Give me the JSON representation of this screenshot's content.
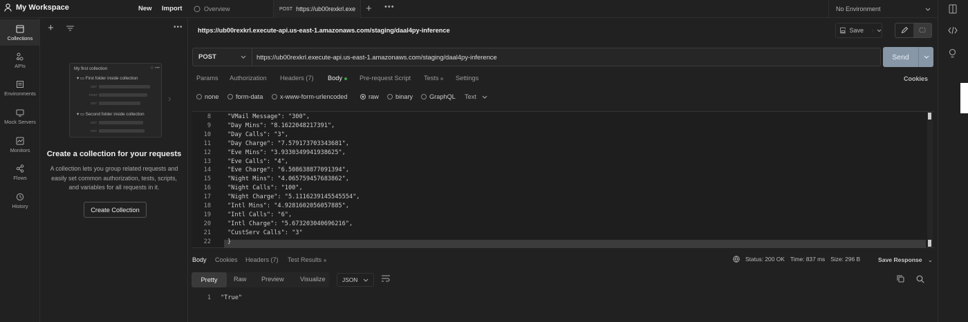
{
  "workspace": {
    "name": "My Workspace",
    "new_label": "New",
    "import_label": "Import"
  },
  "tabs": [
    {
      "label": "Overview"
    },
    {
      "method": "POST",
      "label": "https://ub00rexkrl.exe"
    }
  ],
  "environment": {
    "selected": "No Environment"
  },
  "left_nav": [
    {
      "label": "Collections"
    },
    {
      "label": "APIs"
    },
    {
      "label": "Environments"
    },
    {
      "label": "Mock Servers"
    },
    {
      "label": "Monitors"
    },
    {
      "label": "Flows"
    },
    {
      "label": "History"
    }
  ],
  "sidebar": {
    "illustration": {
      "collection": "My first collection",
      "folder1": "First folder inside collection",
      "folder2": "Second folder inside collection",
      "methods": [
        "GET",
        "POST",
        "GET",
        "GET",
        "GET"
      ]
    },
    "empty_title": "Create a collection for your requests",
    "empty_desc": "A collection lets you group related requests and easily set common authorization, tests, scripts, and variables for all requests in it.",
    "create_button": "Create Collection"
  },
  "request": {
    "title": "https://ub00rexkrl.execute-api.us-east-1.amazonaws.com/staging/daal4py-inference",
    "save_label": "Save",
    "method": "POST",
    "url": "https://ub00rexkrl.execute-api.us-east-1.amazonaws.com/staging/daal4py-inference",
    "send_label": "Send",
    "tabs": [
      "Params",
      "Authorization",
      "Headers (7)",
      "Body",
      "Pre-request Script",
      "Tests",
      "Settings"
    ],
    "cookies_label": "Cookies",
    "body_options": [
      "none",
      "form-data",
      "x-www-form-urlencoded",
      "raw",
      "binary",
      "GraphQL"
    ],
    "body_type": "Text",
    "body_lines": [
      {
        "n": "8",
        "text": "\"VMail Message\": \"300\","
      },
      {
        "n": "9",
        "text": "\"Day Mins\": \"8.1622048217391\","
      },
      {
        "n": "10",
        "text": "\"Day Calls\": \"3\","
      },
      {
        "n": "11",
        "text": "\"Day Charge\": \"7.579173703343681\","
      },
      {
        "n": "12",
        "text": "\"Eve Mins\": \"3.9330349941938625\","
      },
      {
        "n": "13",
        "text": "\"Eve Calls\": \"4\","
      },
      {
        "n": "14",
        "text": "\"Eve Charge\": \"6.508638877091394\","
      },
      {
        "n": "15",
        "text": "\"Night Mins\": \"4.065759457683862\","
      },
      {
        "n": "16",
        "text": "\"Night Calls\": \"100\","
      },
      {
        "n": "17",
        "text": "\"Night Charge\": \"5.1116239145545554\","
      },
      {
        "n": "18",
        "text": "\"Intl Mins\": \"4.9281602056057885\","
      },
      {
        "n": "19",
        "text": "\"Intl Calls\": \"6\","
      },
      {
        "n": "20",
        "text": "\"Intl Charge\": \"5.673203040696216\","
      },
      {
        "n": "21",
        "text": "\"CustServ Calls\": \"3\""
      },
      {
        "n": "22",
        "text": "}"
      }
    ]
  },
  "response": {
    "tabs": [
      "Body",
      "Cookies",
      "Headers (7)",
      "Test Results"
    ],
    "status": "Status: 200 OK",
    "time": "Time: 837 ms",
    "size": "Size: 296 B",
    "save_label": "Save Response",
    "formats": [
      "Pretty",
      "Raw",
      "Preview",
      "Visualize"
    ],
    "language": "JSON",
    "line_number": "1",
    "body": "\"True\""
  },
  "colors": {
    "background": "#212121",
    "send_button": "#8897a7",
    "body_dot": "#3fa34d"
  }
}
